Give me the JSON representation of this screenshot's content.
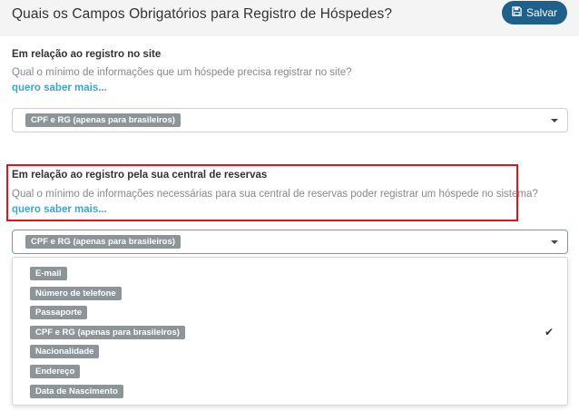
{
  "header": {
    "title": "Quais os Campos Obrigatórios para Registro de Hóspedes?",
    "save_label": "Salvar"
  },
  "site_section": {
    "title": "Em relação ao registro no site",
    "description": "Qual o mínimo de informações que um hóspede precisa registrar no site?",
    "link": "quero saber mais...",
    "selected": "CPF e RG (apenas para brasileiros)"
  },
  "central_section": {
    "title": "Em relação ao registro pela sua central de reservas",
    "description": "Qual o mínimo de informações necessárias para sua central de reservas poder registrar um hóspede no sistema?",
    "link": "quero saber mais...",
    "selected": "CPF e RG (apenas para brasileiros)"
  },
  "dropdown": {
    "options": [
      {
        "label": "E-mail",
        "selected": false
      },
      {
        "label": "Número de telefone",
        "selected": false
      },
      {
        "label": "Passaporte",
        "selected": false
      },
      {
        "label": "CPF e RG (apenas para brasileiros)",
        "selected": true
      },
      {
        "label": "Nacionalidade",
        "selected": false
      },
      {
        "label": "Endereço",
        "selected": false
      },
      {
        "label": "Data de Nascimento",
        "selected": false
      }
    ]
  },
  "colors": {
    "accent": "#1f5f8b",
    "link": "#3fa6c9",
    "tag": "#8e9599",
    "highlight": "#e0141a"
  }
}
